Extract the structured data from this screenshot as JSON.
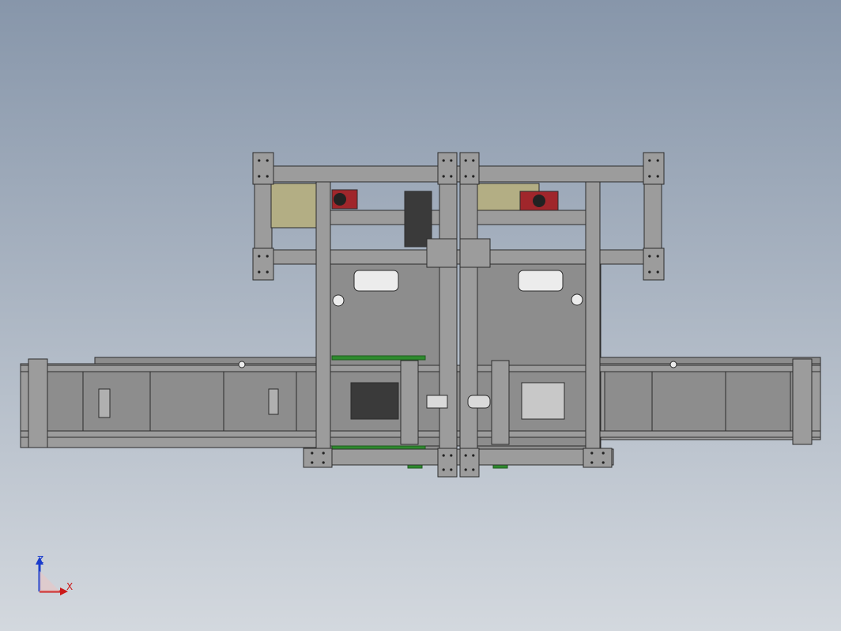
{
  "viewport": {
    "background_top": "#8796aa",
    "background_bottom": "#d3d8de"
  },
  "colors": {
    "frame_fill": "#9c9c9c",
    "frame_dark": "#6e6e6e",
    "plate_fill": "#8d8d8d",
    "outline": "#2c2c2c",
    "bracket_fill": "#b3ae84",
    "motor_red": "#a0262b",
    "green_rail": "#2e8b2e",
    "axis_z": "#1a3ccc",
    "axis_x": "#cc1a1a"
  },
  "triad": {
    "z_label": "Z",
    "x_label": "X",
    "z_icon": "z-axis-arrow-icon",
    "x_icon": "x-axis-arrow-icon"
  }
}
